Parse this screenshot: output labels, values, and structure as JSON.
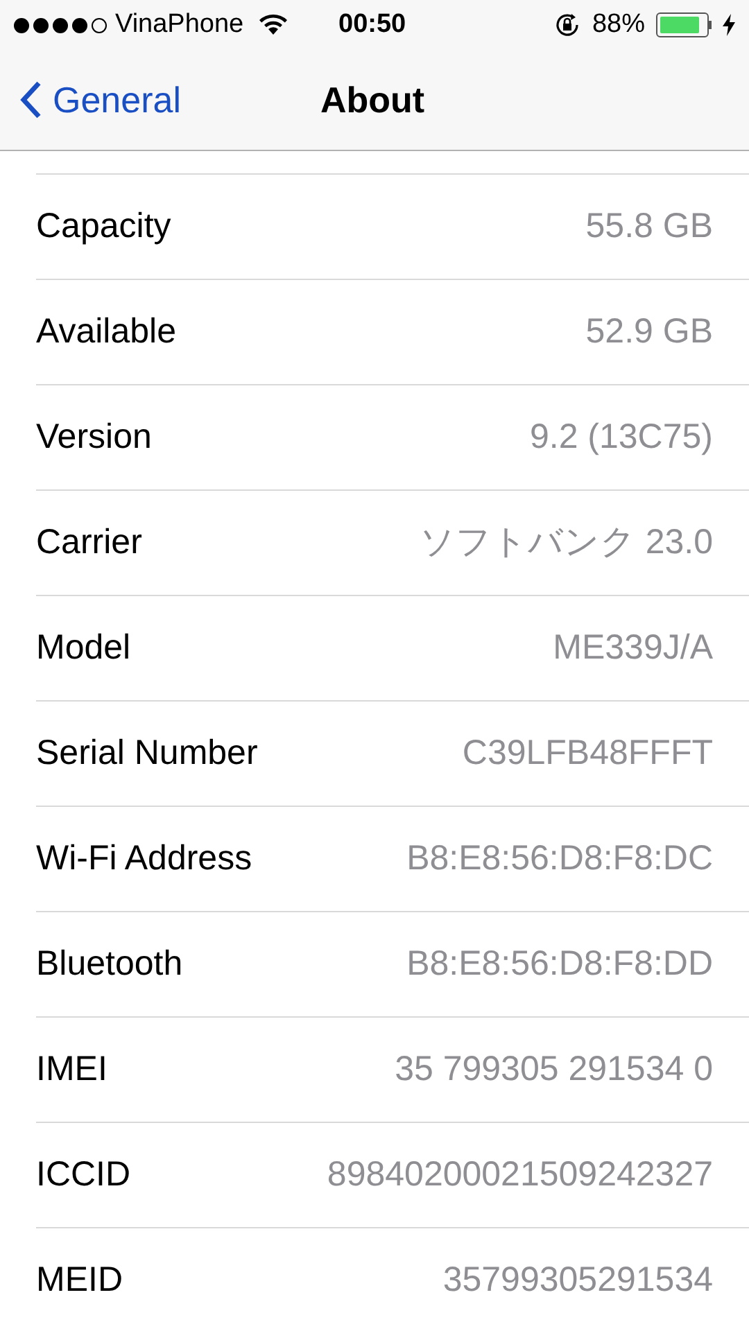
{
  "status_bar": {
    "carrier": "VinaPhone",
    "time": "00:50",
    "battery": "88%"
  },
  "nav": {
    "back": "General",
    "title": "About"
  },
  "rows": [
    {
      "label": "Capacity",
      "value": "55.8 GB"
    },
    {
      "label": "Available",
      "value": "52.9 GB"
    },
    {
      "label": "Version",
      "value": "9.2 (13C75)"
    },
    {
      "label": "Carrier",
      "value": "ソフトバンク 23.0"
    },
    {
      "label": "Model",
      "value": "ME339J/A"
    },
    {
      "label": "Serial Number",
      "value": "C39LFB48FFFT"
    },
    {
      "label": "Wi-Fi Address",
      "value": "B8:E8:56:D8:F8:DC"
    },
    {
      "label": "Bluetooth",
      "value": "B8:E8:56:D8:F8:DD"
    },
    {
      "label": "IMEI",
      "value": "35 799305 291534 0"
    },
    {
      "label": "ICCID",
      "value": "89840200021509242327"
    },
    {
      "label": "MEID",
      "value": "35799305291534"
    }
  ]
}
